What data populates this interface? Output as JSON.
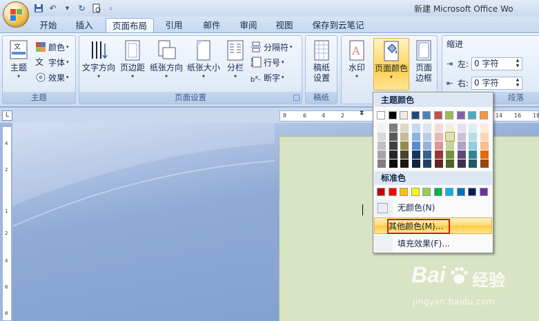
{
  "window": {
    "title": "新建 Microsoft Office Wo"
  },
  "tabs": [
    "开始",
    "插入",
    "页面布局",
    "引用",
    "邮件",
    "审阅",
    "视图",
    "保存到云笔记"
  ],
  "active_tab": "页面布局",
  "ribbon": {
    "theme_group": {
      "label": "主题",
      "theme_btn": "主题",
      "colors": "颜色",
      "fonts": "字体",
      "effects": "效果"
    },
    "page_setup_group": {
      "label": "页面设置",
      "text_direction": "文字方向",
      "margins": "页边距",
      "orientation": "纸张方向",
      "size": "纸张大小",
      "columns": "分栏",
      "breaks": "分隔符",
      "line_numbers": "行号",
      "hyphenation": "断字"
    },
    "draft_group": {
      "label": "稿纸",
      "draft_settings_1": "稿纸",
      "draft_settings_2": "设置"
    },
    "page_bg_group": {
      "watermark": "水印",
      "page_color_1": "页面颜色",
      "page_border_1": "页面",
      "page_border_2": "边框"
    },
    "paragraph_group": {
      "label": "段落",
      "indent": "缩进",
      "left_label": "左:",
      "right_label": "右:",
      "left_value": "0 字符",
      "right_value": "0 字符"
    }
  },
  "hruler_labels": [
    "8",
    "6",
    "4",
    "2",
    "2",
    "14",
    "16",
    "18"
  ],
  "vruler_labels": [
    "4",
    "2",
    "1",
    "2",
    "4",
    "6",
    "8"
  ],
  "dropdown": {
    "theme_colors_header": "主题颜色",
    "standard_colors_header": "标准色",
    "no_color": "无颜色(N)",
    "more_colors": "其他颜色(M)...",
    "fill_effects": "填充效果(F)...",
    "theme_top_row": [
      "#ffffff",
      "#000000",
      "#eeece1",
      "#1f497d",
      "#4f81bd",
      "#c0504d",
      "#9bbb59",
      "#8064a2",
      "#4bacc6",
      "#f79646"
    ],
    "theme_shades": [
      [
        "#f2f2f2",
        "#d8d8d8",
        "#bfbfbf",
        "#a5a5a5",
        "#7f7f7f"
      ],
      [
        "#7f7f7f",
        "#595959",
        "#3f3f3f",
        "#262626",
        "#0c0c0c"
      ],
      [
        "#ddd9c3",
        "#c4bd97",
        "#938953",
        "#494429",
        "#1d1b10"
      ],
      [
        "#c6d9f0",
        "#8db3e2",
        "#548dd4",
        "#17365d",
        "#0f243e"
      ],
      [
        "#dbe5f1",
        "#b8cce4",
        "#95b3d7",
        "#366092",
        "#244061"
      ],
      [
        "#f2dcdb",
        "#e5b9b7",
        "#d99694",
        "#953734",
        "#632423"
      ],
      [
        "#ebf1dd",
        "#d7e3bc",
        "#c3d69b",
        "#76923c",
        "#4f6128"
      ],
      [
        "#e5e0ec",
        "#ccc1d9",
        "#b2a2c7",
        "#5f497a",
        "#3f3151"
      ],
      [
        "#dbeef3",
        "#b7dde8",
        "#92cddc",
        "#31859b",
        "#205867"
      ],
      [
        "#fdeada",
        "#fbd5b5",
        "#fac08f",
        "#e36c09",
        "#974806"
      ]
    ],
    "standard_colors": [
      "#c00000",
      "#ff0000",
      "#ffc000",
      "#ffff00",
      "#92d050",
      "#00b050",
      "#00b0f0",
      "#0070c0",
      "#002060",
      "#7030a0"
    ]
  },
  "watermark": {
    "brand": "Bai",
    "brand2": "经验",
    "url": "jingyan.baidu.com"
  },
  "colors": {
    "page_bg": "#d8e4c3",
    "highlight": "#ffd96b",
    "red_box": "#d51a1a"
  }
}
